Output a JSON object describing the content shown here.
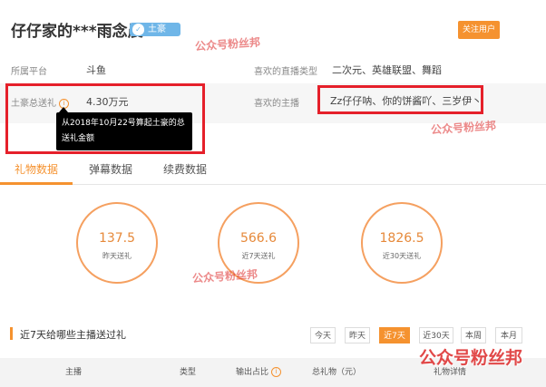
{
  "header": {
    "title": "仔仔家的***雨念晨",
    "badge_label": "土豪",
    "follow_label": "关注用户"
  },
  "info": {
    "platform_label": "所属平台",
    "platform_value": "斗鱼",
    "live_type_label": "喜欢的直播类型",
    "live_type_value": "二次元、英雄联盟、舞蹈",
    "gift_total_label": "土豪总送礼",
    "gift_total_value": "4.30万元",
    "fav_streamer_label": "喜欢的主播",
    "fav_streamer_value": "Zz仔仔呐、你的饼酱吖、三岁伊丶",
    "info_icon_glyph": "i"
  },
  "tooltip": {
    "line1": "从2018年10月22号算起土豪的总",
    "line2": "送礼金额"
  },
  "tabs": [
    {
      "label": "礼物数据",
      "active": true
    },
    {
      "label": "弹幕数据",
      "active": false
    },
    {
      "label": "续费数据",
      "active": false
    }
  ],
  "stats": [
    {
      "value": "137.5",
      "caption": "昨天送礼"
    },
    {
      "value": "566.6",
      "caption": "近7天送礼"
    },
    {
      "value": "1826.5",
      "caption": "近30天送礼"
    }
  ],
  "section": {
    "title": "近7天给哪些主播送过礼"
  },
  "filters": [
    {
      "label": "今天",
      "active": false
    },
    {
      "label": "昨天",
      "active": false
    },
    {
      "label": "近7天",
      "active": true
    },
    {
      "label": "近30天",
      "active": false
    },
    {
      "label": "本周",
      "active": false
    },
    {
      "label": "本月",
      "active": false
    }
  ],
  "table": {
    "columns": [
      "主播",
      "类型",
      "输出占比",
      "总礼物（元）",
      "礼物详情"
    ]
  },
  "watermark": {
    "text": "公众号粉丝邦"
  },
  "colors": {
    "accent": "#f5922f",
    "highlight_box": "#e5202a",
    "badge": "#6fb6e8"
  }
}
